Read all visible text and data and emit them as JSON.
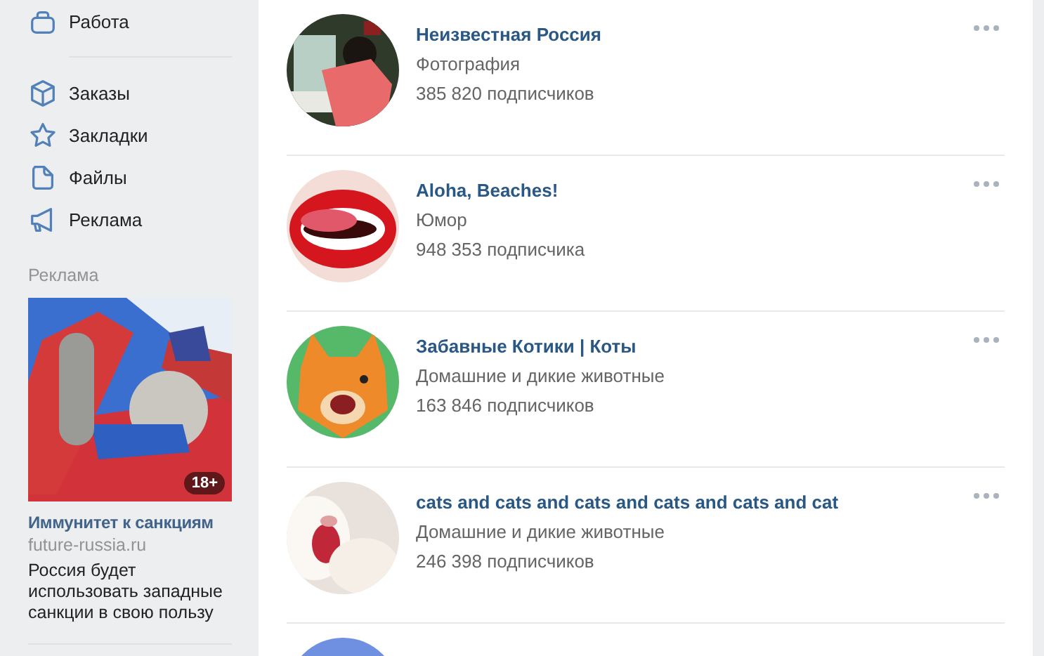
{
  "sidebar": {
    "top_items": [
      {
        "label": "Работа"
      }
    ],
    "items": [
      {
        "label": "Заказы"
      },
      {
        "label": "Закладки"
      },
      {
        "label": "Файлы"
      },
      {
        "label": "Реклама"
      }
    ],
    "ad": {
      "heading": "Реклама",
      "age_badge": "18+",
      "title": "Иммунитет к санкциям",
      "domain": "future-russia.ru",
      "text": "Россия будет использовать западные санкции в свою пользу"
    }
  },
  "communities": [
    {
      "name": "Неизвестная Россия",
      "category": "Фотография",
      "followers": "385 820 подписчиков"
    },
    {
      "name": "Aloha, Beaches!",
      "category": "Юмор",
      "followers": "948 353 подписчика"
    },
    {
      "name": "Забавные Котики | Коты",
      "category": "Домашние и дикие животные",
      "followers": "163 846 подписчиков"
    },
    {
      "name": "cats and cats and cats and cats and cats and cat",
      "category": "Домашние и дикие животные",
      "followers": "246 398 подписчиков"
    },
    {
      "kind": "picture"
    }
  ]
}
